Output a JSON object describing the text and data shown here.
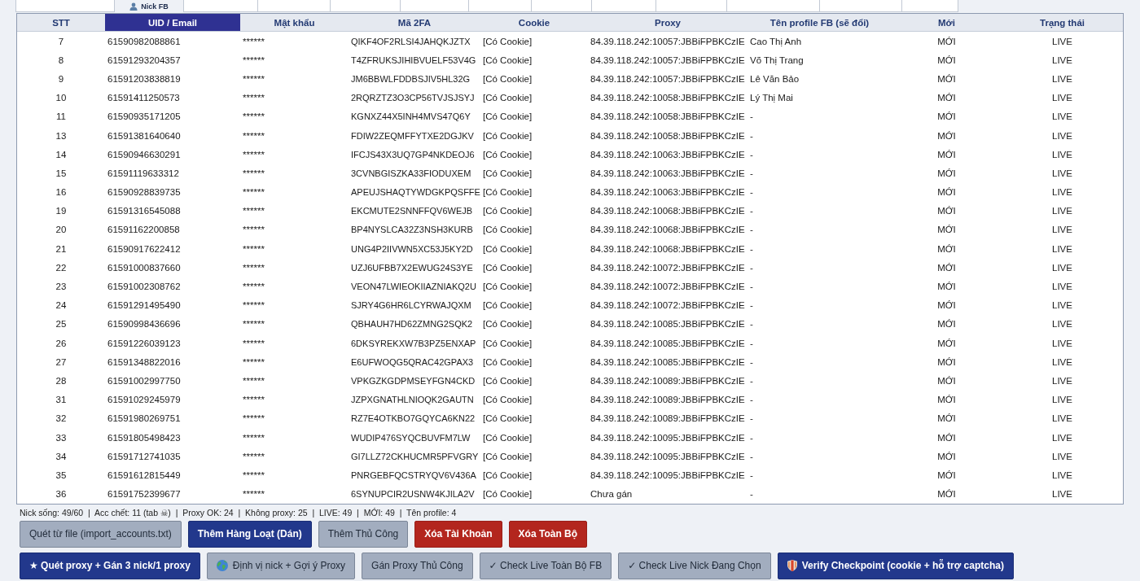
{
  "tabs": [
    {
      "selected": false
    },
    {
      "label": "Nick FB",
      "selected": true
    },
    {
      "selected": false
    },
    {
      "selected": false
    },
    {
      "selected": false
    },
    {
      "selected": false
    },
    {
      "selected": false
    },
    {
      "selected": false
    },
    {
      "selected": false
    },
    {
      "selected": false
    },
    {
      "selected": false
    },
    {
      "selected": false
    },
    {
      "selected": false
    }
  ],
  "table": {
    "columns": [
      {
        "label": "STT",
        "selected": false
      },
      {
        "label": "UID / Email",
        "selected": true
      },
      {
        "label": "Mật khẩu",
        "selected": false
      },
      {
        "label": "Mã 2FA",
        "selected": false
      },
      {
        "label": "Cookie",
        "selected": false
      },
      {
        "label": "Proxy",
        "selected": false
      },
      {
        "label": "Tên profile FB (sẽ đổi)",
        "selected": false
      },
      {
        "label": "Mới",
        "selected": false
      },
      {
        "label": "Trạng thái",
        "selected": false
      }
    ],
    "rows": [
      [
        "7",
        "61590982088861",
        "******",
        "QIKF4OF2RLSI4JAHQKJZTX",
        "[Có Cookie]",
        "84.39.118.242:10057:JBBiFPBKCzIE",
        "Cao Thị Anh",
        "MỚI",
        "LIVE"
      ],
      [
        "8",
        "61591293204357",
        "******",
        "T4ZFRUKSJIHIBVUELF53V4G",
        "[Có Cookie]",
        "84.39.118.242:10057:JBBiFPBKCzIE",
        "Võ Thị Trang",
        "MỚI",
        "LIVE"
      ],
      [
        "9",
        "61591203838819",
        "******",
        "JM6BBWLFDDBSJIV5HL32G",
        "[Có Cookie]",
        "84.39.118.242:10057:JBBiFPBKCzIE",
        "Lê Văn Bảo",
        "MỚI",
        "LIVE"
      ],
      [
        "10",
        "61591411250573",
        "******",
        "2RQRZTZ3O3CP56TVJSJSYJ",
        "[Có Cookie]",
        "84.39.118.242:10058:JBBiFPBKCzIE",
        "Lý Thị Mai",
        "MỚI",
        "LIVE"
      ],
      [
        "11",
        "61590935171205",
        "******",
        "KGNXZ44X5INH4MVS47Q6Y",
        "[Có Cookie]",
        "84.39.118.242:10058:JBBiFPBKCzIE",
        "-",
        "MỚI",
        "LIVE"
      ],
      [
        "13",
        "61591381640640",
        "******",
        "FDIW2ZEQMFFYTXE2DGJKV",
        "[Có Cookie]",
        "84.39.118.242:10058:JBBiFPBKCzIE",
        "-",
        "MỚI",
        "LIVE"
      ],
      [
        "14",
        "61590946630291",
        "******",
        "IFCJS43X3UQ7GP4NKDEOJ6",
        "[Có Cookie]",
        "84.39.118.242:10063:JBBiFPBKCzIE",
        "-",
        "MỚI",
        "LIVE"
      ],
      [
        "15",
        "61591119633312",
        "******",
        "3CVNBGISZKA33FIODUXEM",
        "[Có Cookie]",
        "84.39.118.242:10063:JBBiFPBKCzIE",
        "-",
        "MỚI",
        "LIVE"
      ],
      [
        "16",
        "61590928839735",
        "******",
        "APEUJSHAQTYWDGKPQSFFE",
        "[Có Cookie]",
        "84.39.118.242:10063:JBBiFPBKCzIE",
        "-",
        "MỚI",
        "LIVE"
      ],
      [
        "19",
        "61591316545088",
        "******",
        "EKCMUTE2SNNFFQV6WEJB",
        "[Có Cookie]",
        "84.39.118.242:10068:JBBiFPBKCzIE",
        "-",
        "MỚI",
        "LIVE"
      ],
      [
        "20",
        "61591162200858",
        "******",
        "BP4NYSLCA32Z3NSH3KURB",
        "[Có Cookie]",
        "84.39.118.242:10068:JBBiFPBKCzIE",
        "-",
        "MỚI",
        "LIVE"
      ],
      [
        "21",
        "61590917622412",
        "******",
        "UNG4P2IIVWN5XC53J5KY2D",
        "[Có Cookie]",
        "84.39.118.242:10068:JBBiFPBKCzIE",
        "-",
        "MỚI",
        "LIVE"
      ],
      [
        "22",
        "61591000837660",
        "******",
        "UZJ6UFBB7X2EWUG24S3YE",
        "[Có Cookie]",
        "84.39.118.242:10072:JBBiFPBKCzIE",
        "-",
        "MỚI",
        "LIVE"
      ],
      [
        "23",
        "61591002308762",
        "******",
        "VEON47LWIEOKIIAZNIAKQ2U",
        "[Có Cookie]",
        "84.39.118.242:10072:JBBiFPBKCzIE",
        "-",
        "MỚI",
        "LIVE"
      ],
      [
        "24",
        "61591291495490",
        "******",
        "SJRY4G6HR6LCYRWAJQXM",
        "[Có Cookie]",
        "84.39.118.242:10072:JBBiFPBKCzIE",
        "-",
        "MỚI",
        "LIVE"
      ],
      [
        "25",
        "61590998436696",
        "******",
        "QBHAUH7HD62ZMNG2SQK2",
        "[Có Cookie]",
        "84.39.118.242:10085:JBBiFPBKCzIE",
        "-",
        "MỚI",
        "LIVE"
      ],
      [
        "26",
        "61591226039123",
        "******",
        "6DKSYREKXW7B3PZ5ENXAP",
        "[Có Cookie]",
        "84.39.118.242:10085:JBBiFPBKCzIE",
        "-",
        "MỚI",
        "LIVE"
      ],
      [
        "27",
        "61591348822016",
        "******",
        "E6UFWOQG5QRAC42GPAX3",
        "[Có Cookie]",
        "84.39.118.242:10085:JBBiFPBKCzIE",
        "-",
        "MỚI",
        "LIVE"
      ],
      [
        "28",
        "61591002997750",
        "******",
        "VPKGZKGDPMSEYFGN4CKD",
        "[Có Cookie]",
        "84.39.118.242:10089:JBBiFPBKCzIE",
        "-",
        "MỚI",
        "LIVE"
      ],
      [
        "31",
        "61591029245979",
        "******",
        "JZPXGNATHLNIOQK2GAUTN",
        "[Có Cookie]",
        "84.39.118.242:10089:JBBiFPBKCzIE",
        "-",
        "MỚI",
        "LIVE"
      ],
      [
        "32",
        "61591980269751",
        "******",
        "RZ7E4OTKBO7GQYCA6KN22",
        "[Có Cookie]",
        "84.39.118.242:10089:JBBiFPBKCzIE",
        "-",
        "MỚI",
        "LIVE"
      ],
      [
        "33",
        "61591805498423",
        "******",
        "WUDIP476SYQCBUVFM7LW",
        "[Có Cookie]",
        "84.39.118.242:10095:JBBiFPBKCzIE",
        "-",
        "MỚI",
        "LIVE"
      ],
      [
        "34",
        "61591712741035",
        "******",
        "GI7LLZ72CKHUCMR5PFVGRY",
        "[Có Cookie]",
        "84.39.118.242:10095:JBBiFPBKCzIE",
        "-",
        "MỚI",
        "LIVE"
      ],
      [
        "35",
        "61591612815449",
        "******",
        "PNRGEBFQCSTRYQV6V436A",
        "[Có Cookie]",
        "84.39.118.242:10095:JBBiFPBKCzIE",
        "-",
        "MỚI",
        "LIVE"
      ],
      [
        "36",
        "61591752399677",
        "******",
        "6SYNUPCIR2USNW4KJILA2V",
        "[Có Cookie]",
        "Chưa gán",
        "-",
        "MỚI",
        "LIVE"
      ]
    ]
  },
  "status_bar": {
    "text": "Nick sống: 49/60  |  Acc chết: 11 (tab ☠)  |  Proxy OK: 24  |  Không proxy: 25  |  LIVE: 49  |  MỚI: 49  |  Tên profile: 4"
  },
  "button_rows": [
    [
      {
        "label": "Quét từ file (import_accounts.txt)",
        "kind": "secondary"
      },
      {
        "label": "Thêm Hàng Loạt (Dán)",
        "kind": "primary"
      },
      {
        "label": "Thêm Thủ Công",
        "kind": "secondary"
      },
      {
        "label": "Xóa Tài Khoản",
        "kind": "danger"
      },
      {
        "label": "Xóa Toàn Bộ",
        "kind": "danger"
      }
    ],
    [
      {
        "label": "★ Quét proxy + Gán 3 nick/1 proxy",
        "kind": "primary"
      },
      {
        "label": "Định vị nick + Gợi ý Proxy",
        "kind": "secondary"
      },
      {
        "label": "Gán Proxy Thủ Công",
        "kind": "secondary"
      },
      {
        "label": "✓ Check Live Toàn Bộ FB",
        "kind": "secondary"
      },
      {
        "label": "✓ Check Live Nick Đang Chọn",
        "kind": "secondary"
      },
      {
        "label": "Verify Checkpoint (cookie + hỗ trợ captcha)",
        "kind": "primary"
      }
    ]
  ]
}
